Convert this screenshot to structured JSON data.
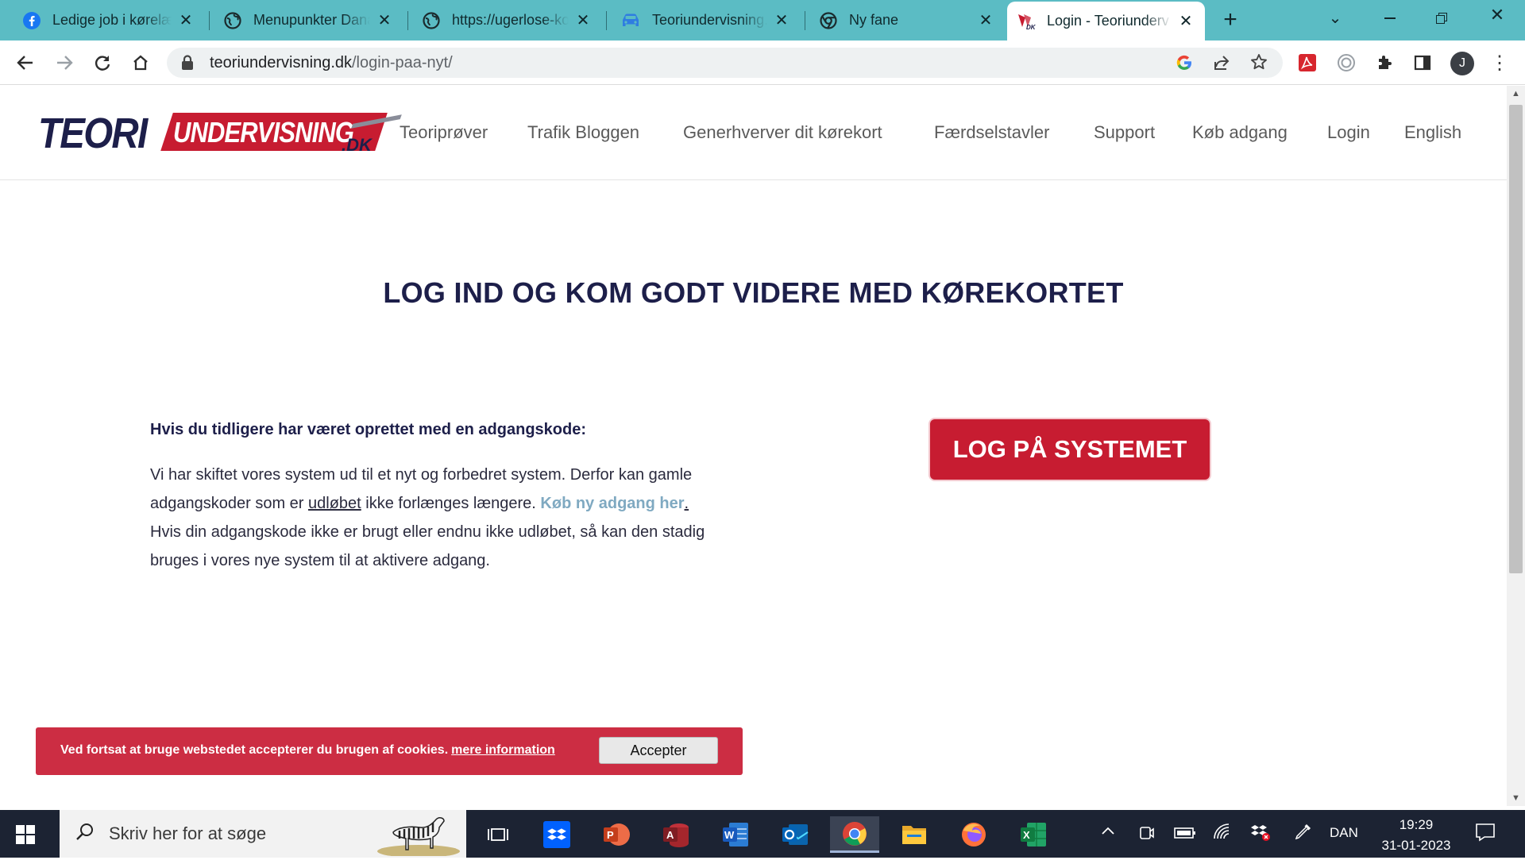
{
  "browser": {
    "tabs": [
      {
        "title": "Ledige job i kørelæ",
        "icon": "facebook-icon"
      },
      {
        "title": "Menupunkter Dana",
        "icon": "globe-icon"
      },
      {
        "title": "https://ugerlose-ko",
        "icon": "globe-icon"
      },
      {
        "title": "Teoriundervisning.d",
        "icon": "car-icon"
      },
      {
        "title": "Ny fane",
        "icon": "chrome-icon"
      },
      {
        "title": "Login - Teoriunderv",
        "icon": "teori-favicon",
        "active": true
      }
    ],
    "url_host": "teoriundervisning.dk",
    "url_path": "/login-paa-nyt/",
    "profile_initial": "J"
  },
  "site": {
    "logo": {
      "part1": "TEORI",
      "part2": "UNDERVISNING",
      "part3": ".DK"
    },
    "nav": [
      "Teoriprøver",
      "Trafik Bloggen",
      "Generhverver dit kørekort",
      "Færdselstavler",
      "Support",
      "Køb adgang",
      "Login",
      "English"
    ]
  },
  "main": {
    "heading": "LOG IND OG KOM GODT VIDERE MED KØREKORTET",
    "intro_bold": "Hvis du tidligere har været oprettet med en adgangskode:",
    "p1_a": "Vi har skiftet vores system ud til et nyt og forbedret system. Derfor kan gamle adgangskoder som er ",
    "p1_link_underline": "udløbet",
    "p1_b": " ikke forlænges længere. ",
    "p1_link": "Køb ny adgang her",
    "p1_dot": ".",
    "p2": "Hvis din adgangskode ikke er brugt eller endnu ikke udløbet, så kan den stadig bruges i vores nye system til at aktivere adgang.",
    "login_button": "LOG PÅ SYSTEMET"
  },
  "cookie": {
    "text": "Ved fortsat at bruge webstedet accepterer du brugen af cookies.",
    "more": "mere information",
    "accept": "Accepter"
  },
  "taskbar": {
    "search_placeholder": "Skriv her for at søge",
    "lang": "DAN",
    "time": "19:29",
    "date": "31-01-2023"
  },
  "colors": {
    "tabstrip": "#5bbcc4",
    "brand_red": "#c71c31",
    "brand_navy": "#1d1f4a",
    "link": "#7fa9c1",
    "taskbar": "#1c2333"
  }
}
